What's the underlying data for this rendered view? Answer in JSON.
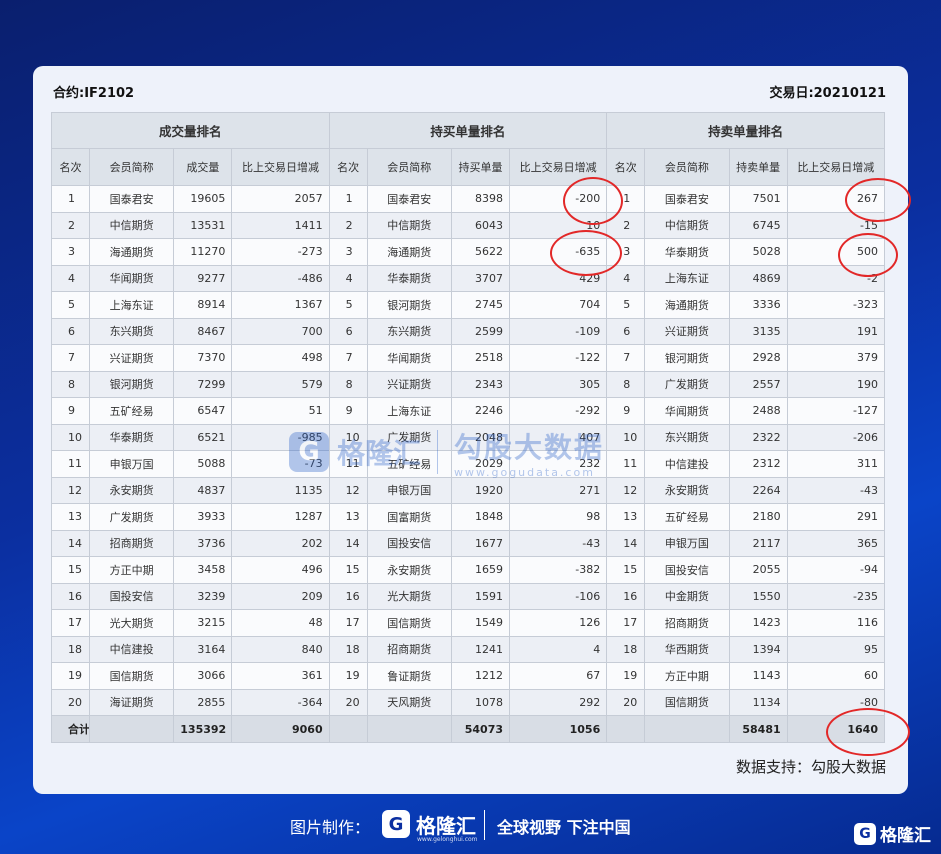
{
  "header": {
    "contract": "合约:IF2102",
    "trade_date": "交易日:20210121"
  },
  "groups": [
    "成交量排名",
    "持买单量排名",
    "持卖单量排名"
  ],
  "columns": [
    "名次",
    "会员简称",
    "成交量",
    "比上交易日增减",
    "名次",
    "会员简称",
    "持买单量",
    "比上交易日增减",
    "名次",
    "会员简称",
    "持卖单量",
    "比上交易日增减"
  ],
  "rows": [
    [
      "1",
      "国泰君安",
      "19605",
      "2057",
      "1",
      "国泰君安",
      "8398",
      "-200",
      "1",
      "国泰君安",
      "7501",
      "267"
    ],
    [
      "2",
      "中信期货",
      "13531",
      "1411",
      "2",
      "中信期货",
      "6043",
      "10",
      "2",
      "中信期货",
      "6745",
      "-15"
    ],
    [
      "3",
      "海通期货",
      "11270",
      "-273",
      "3",
      "海通期货",
      "5622",
      "-635",
      "3",
      "华泰期货",
      "5028",
      "500"
    ],
    [
      "4",
      "华闻期货",
      "9277",
      "-486",
      "4",
      "华泰期货",
      "3707",
      "429",
      "4",
      "上海东证",
      "4869",
      "-2"
    ],
    [
      "5",
      "上海东证",
      "8914",
      "1367",
      "5",
      "银河期货",
      "2745",
      "704",
      "5",
      "海通期货",
      "3336",
      "-323"
    ],
    [
      "6",
      "东兴期货",
      "8467",
      "700",
      "6",
      "东兴期货",
      "2599",
      "-109",
      "6",
      "兴证期货",
      "3135",
      "191"
    ],
    [
      "7",
      "兴证期货",
      "7370",
      "498",
      "7",
      "华闻期货",
      "2518",
      "-122",
      "7",
      "银河期货",
      "2928",
      "379"
    ],
    [
      "8",
      "银河期货",
      "7299",
      "579",
      "8",
      "兴证期货",
      "2343",
      "305",
      "8",
      "广发期货",
      "2557",
      "190"
    ],
    [
      "9",
      "五矿经易",
      "6547",
      "51",
      "9",
      "上海东证",
      "2246",
      "-292",
      "9",
      "华闻期货",
      "2488",
      "-127"
    ],
    [
      "10",
      "华泰期货",
      "6521",
      "-985",
      "10",
      "广发期货",
      "2048",
      "407",
      "10",
      "东兴期货",
      "2322",
      "-206"
    ],
    [
      "11",
      "申银万国",
      "5088",
      "-73",
      "11",
      "五矿经易",
      "2029",
      "232",
      "11",
      "中信建投",
      "2312",
      "311"
    ],
    [
      "12",
      "永安期货",
      "4837",
      "1135",
      "12",
      "申银万国",
      "1920",
      "271",
      "12",
      "永安期货",
      "2264",
      "-43"
    ],
    [
      "13",
      "广发期货",
      "3933",
      "1287",
      "13",
      "国富期货",
      "1848",
      "98",
      "13",
      "五矿经易",
      "2180",
      "291"
    ],
    [
      "14",
      "招商期货",
      "3736",
      "202",
      "14",
      "国投安信",
      "1677",
      "-43",
      "14",
      "申银万国",
      "2117",
      "365"
    ],
    [
      "15",
      "方正中期",
      "3458",
      "496",
      "15",
      "永安期货",
      "1659",
      "-382",
      "15",
      "国投安信",
      "2055",
      "-94"
    ],
    [
      "16",
      "国投安信",
      "3239",
      "209",
      "16",
      "光大期货",
      "1591",
      "-106",
      "16",
      "中金期货",
      "1550",
      "-235"
    ],
    [
      "17",
      "光大期货",
      "3215",
      "48",
      "17",
      "国信期货",
      "1549",
      "126",
      "17",
      "招商期货",
      "1423",
      "116"
    ],
    [
      "18",
      "中信建投",
      "3164",
      "840",
      "18",
      "招商期货",
      "1241",
      "4",
      "18",
      "华西期货",
      "1394",
      "95"
    ],
    [
      "19",
      "国信期货",
      "3066",
      "361",
      "19",
      "鲁证期货",
      "1212",
      "67",
      "19",
      "方正中期",
      "1143",
      "60"
    ],
    [
      "20",
      "海证期货",
      "2855",
      "-364",
      "20",
      "天风期货",
      "1078",
      "292",
      "20",
      "国信期货",
      "1134",
      "-80"
    ]
  ],
  "totals": {
    "label": "合计",
    "volume": "135392",
    "volume_change": "9060",
    "buy": "54073",
    "buy_change": "1056",
    "sell": "58481",
    "sell_change": "1640"
  },
  "support": "数据支持：勾股大数据",
  "watermark": {
    "logo": "G",
    "brand": "格隆汇",
    "name": "勾股大数据",
    "url": "www.gogudata.com"
  },
  "footer": {
    "credit": "图片制作：",
    "logo": "G",
    "brand": "格隆汇",
    "url": "www.gelonghui.com",
    "slogan": "全球视野 下注中国"
  },
  "corner": {
    "logo": "G",
    "brand": "格隆汇"
  },
  "colors": {
    "highlight": "#e22828",
    "background": "#0b2fa0"
  }
}
